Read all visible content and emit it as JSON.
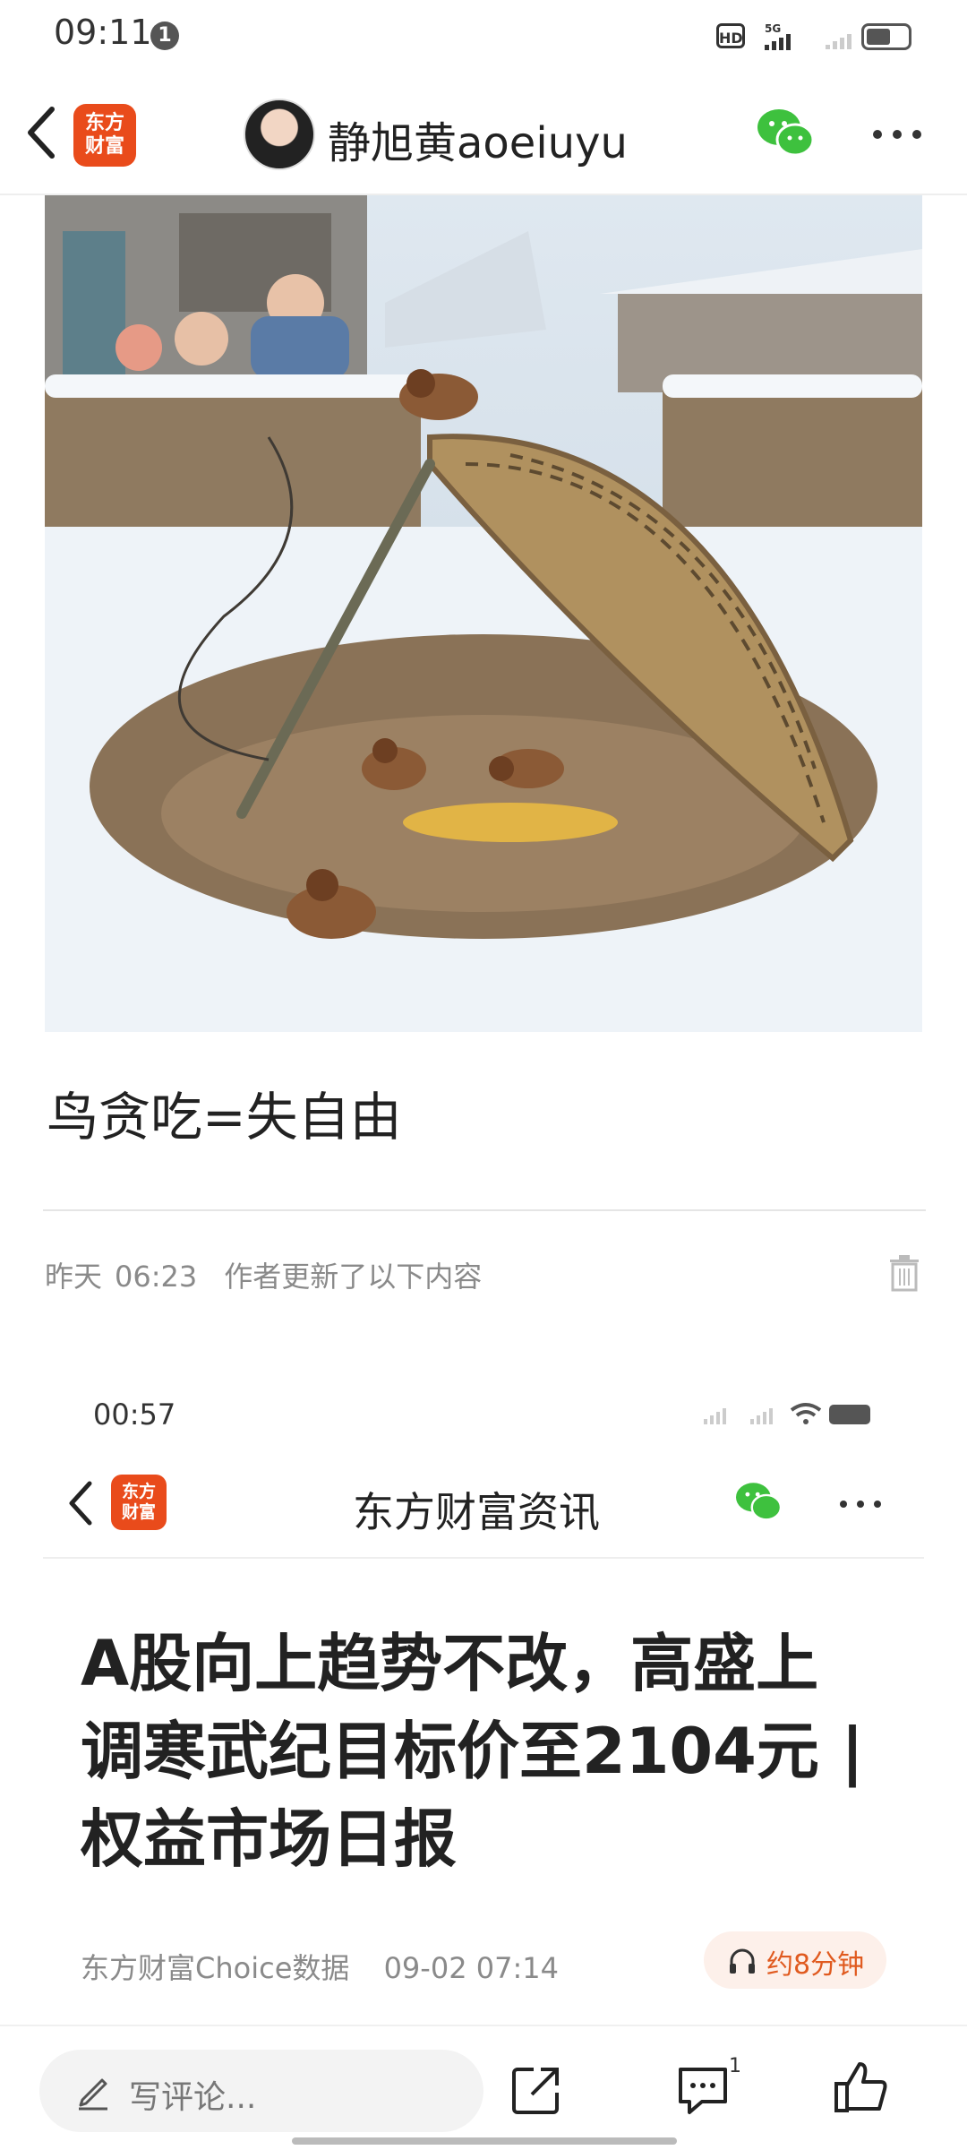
{
  "status_bar": {
    "time": "09:11",
    "notification_count": "1",
    "hd_label": "HD",
    "network": "5G"
  },
  "header": {
    "logo_text_line1": "东方",
    "logo_text_line2": "财富",
    "author_name": "静旭黄aoeiuyu"
  },
  "post": {
    "caption": "鸟贪吃=失自由"
  },
  "update": {
    "date": "昨天",
    "time": "06:23",
    "note": "作者更新了以下内容"
  },
  "embedded": {
    "time": "00:57",
    "logo_text_line1": "东方",
    "logo_text_line2": "财富",
    "title": "东方财富资讯",
    "headline": "A股向上趋势不改，高盛上调寒武纪目标价至2104元 | 权益市场日报",
    "source": "东方财富Choice数据",
    "datetime": "09-02 07:14",
    "listen_label": "约8分钟"
  },
  "bottom_bar": {
    "comment_placeholder": "写评论...",
    "comment_count": "1"
  },
  "colors": {
    "brand": "#e94b1b",
    "wechat": "#3ec13e",
    "listen_accent": "#e05a1f"
  }
}
